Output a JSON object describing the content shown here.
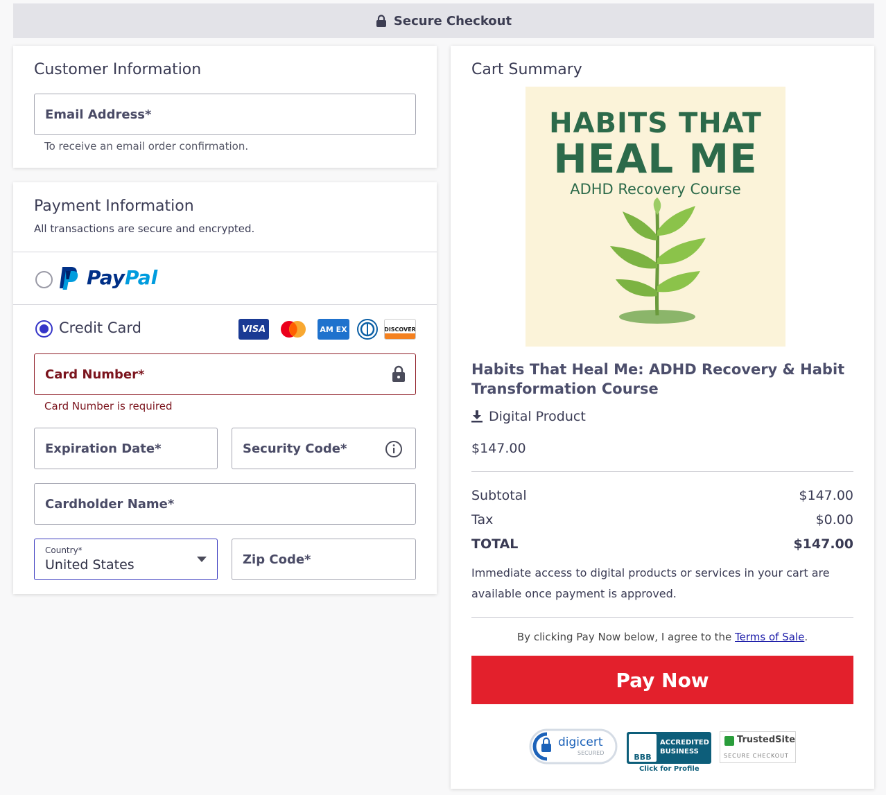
{
  "header": {
    "title": "Secure Checkout",
    "icon": "lock-icon"
  },
  "customer": {
    "heading": "Customer Information",
    "email_placeholder": "Email Address*",
    "email_helper": "To receive an email order confirmation."
  },
  "payment": {
    "heading": "Payment Information",
    "subheading": "All transactions are secure and encrypted.",
    "paypal": {
      "word1": "Pay",
      "word2": "Pal",
      "selected": false
    },
    "credit_card": {
      "label": "Credit Card",
      "selected": true,
      "brands": [
        "visa",
        "mastercard",
        "amex",
        "diners",
        "discover"
      ],
      "visa_text": "VISA",
      "amex_text": "AM EX",
      "discover_text": "DISCOVER"
    },
    "card_number_placeholder": "Card Number*",
    "card_number_error": "Card Number is required",
    "expiration_placeholder": "Expiration Date*",
    "security_code_placeholder": "Security Code*",
    "cardholder_placeholder": "Cardholder Name*",
    "country_label": "Country*",
    "country_value": "United States",
    "zip_placeholder": "Zip Code*"
  },
  "cart": {
    "heading": "Cart Summary",
    "image_text": {
      "line1": "HABITS THAT",
      "line2": "HEAL ME",
      "line3": "ADHD Recovery Course"
    },
    "product_title": "Habits That Heal Me: ADHD Recovery & Habit Transformation Course",
    "product_type": "Digital Product",
    "price": "$147.00",
    "subtotal_label": "Subtotal",
    "subtotal_value": "$147.00",
    "tax_label": "Tax",
    "tax_value": "$0.00",
    "total_label": "TOTAL",
    "total_value": "$147.00",
    "note": "Immediate access to digital products or services in your cart are available once payment is approved.",
    "agree_prefix": "By clicking Pay Now below, I agree to the",
    "agree_link": "Terms of Sale",
    "agree_suffix": ".",
    "pay_button": "Pay Now"
  },
  "badges": {
    "digicert": {
      "name": "digicert",
      "sub": "SECURED"
    },
    "bbb": {
      "line1": "ACCREDITED",
      "line2": "BUSINESS",
      "logo": "BBB",
      "caption": "Click for Profile"
    },
    "trustedsite": {
      "name": "TrustedSite",
      "sub": "SECURE CHECKOUT"
    }
  },
  "colors": {
    "accent": "#3535c8",
    "pay_button": "#e3202c",
    "error": "#7b141d",
    "paypal_dark": "#003087",
    "paypal_light": "#009cde"
  }
}
